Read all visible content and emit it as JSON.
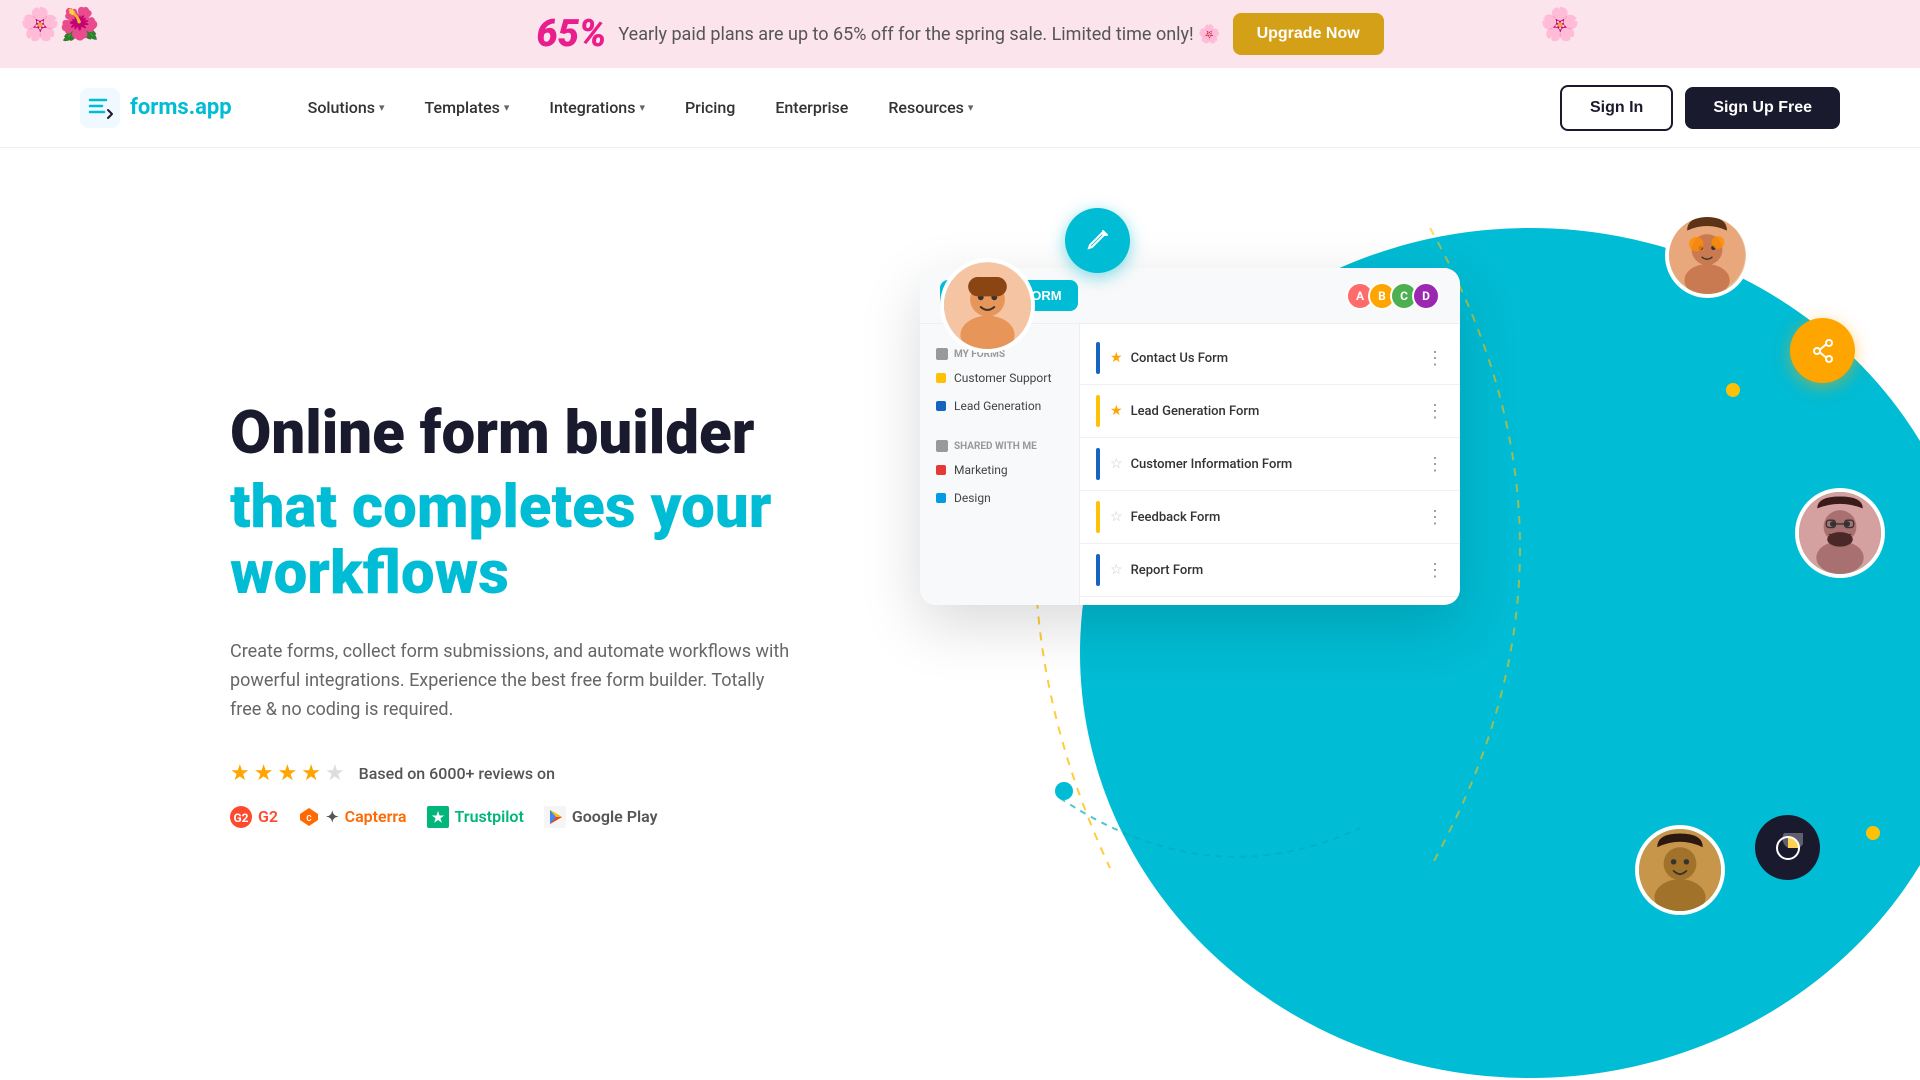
{
  "banner": {
    "percent": "65",
    "percent_symbol": "%",
    "text": "Yearly paid plans are up to 65% off for the spring sale. Limited time only! 🌸",
    "btn_label": "Upgrade Now",
    "flower_left": "🌸",
    "flower_right": "🌸"
  },
  "nav": {
    "logo_text_forms": "forms",
    "logo_text_app": ".app",
    "links": [
      {
        "label": "Solutions",
        "has_chevron": true
      },
      {
        "label": "Templates",
        "has_chevron": true
      },
      {
        "label": "Integrations",
        "has_chevron": true
      },
      {
        "label": "Pricing",
        "has_chevron": false
      },
      {
        "label": "Enterprise",
        "has_chevron": false
      },
      {
        "label": "Resources",
        "has_chevron": true
      }
    ],
    "signin_label": "Sign In",
    "signup_label": "Sign Up Free"
  },
  "hero": {
    "title_line1": "Online form builder",
    "title_line2": "that completes your workflows",
    "description": "Create forms, collect form submissions, and automate workflows with powerful integrations. Experience the best free form builder. Totally free & no coding is required.",
    "reviews_text": "Based on 6000+ reviews on",
    "stars": [
      "★",
      "★",
      "★",
      "★",
      "☆"
    ],
    "review_sources": [
      {
        "name": "G2",
        "label": "G2"
      },
      {
        "name": "Capterra",
        "label": "Capterra"
      },
      {
        "name": "Trustpilot",
        "label": "Trustpilot"
      },
      {
        "name": "Google Play",
        "label": "Google Play"
      }
    ]
  },
  "app_window": {
    "create_btn": "+ CREATE FORM",
    "sidebar": {
      "my_forms_label": "MY FORMS",
      "my_forms_items": [
        {
          "label": "Customer Support",
          "color": "#ffc107"
        },
        {
          "label": "Lead Generation",
          "color": "#1565c0"
        }
      ],
      "shared_label": "SHARED WITH ME",
      "shared_items": [
        {
          "label": "Marketing",
          "color": "#e53935"
        },
        {
          "label": "Design",
          "color": "#039be5"
        }
      ]
    },
    "forms": [
      {
        "name": "Contact Us Form",
        "starred": true,
        "indicator": "#1565c0"
      },
      {
        "name": "Lead Generation Form",
        "starred": true,
        "indicator": "#ffc107"
      },
      {
        "name": "Customer Information Form",
        "starred": false,
        "indicator": "#1565c0"
      },
      {
        "name": "Feedback Form",
        "starred": false,
        "indicator": "#ffc107"
      },
      {
        "name": "Report Form",
        "starred": false,
        "indicator": "#1565c0"
      }
    ]
  },
  "floating": {
    "edit_icon": "✏️",
    "share_icon": "⬆",
    "chart_icon": "📊"
  }
}
